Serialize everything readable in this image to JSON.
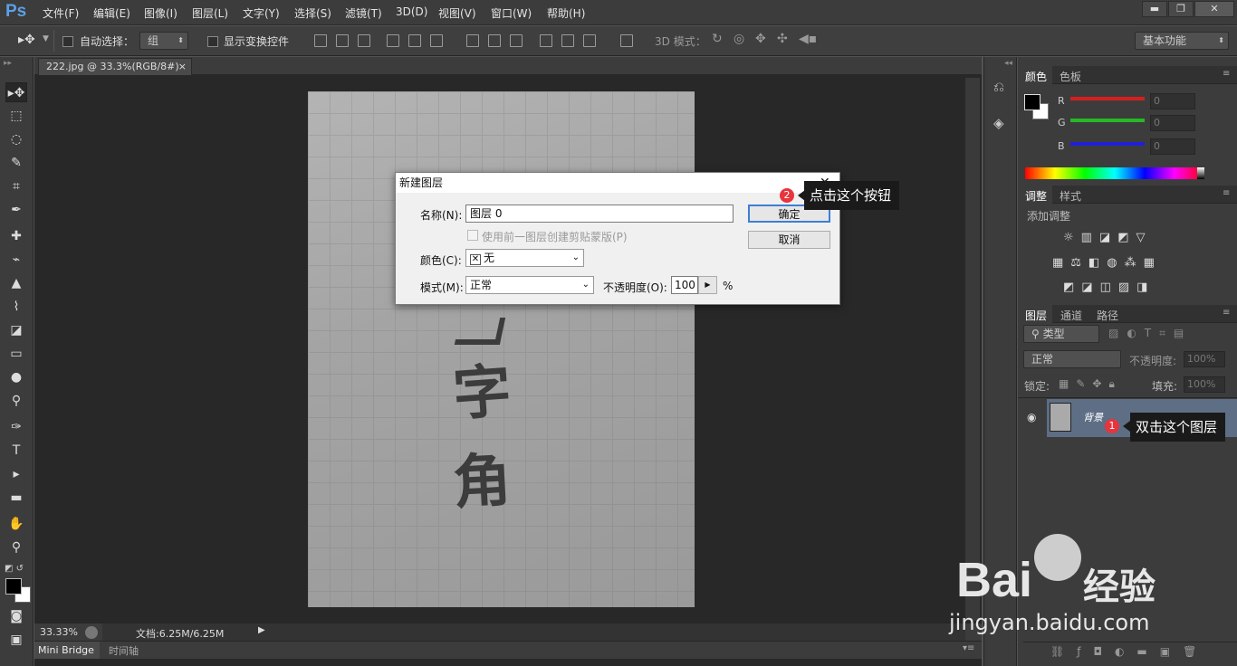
{
  "app": {
    "logo": "Ps"
  },
  "menu": [
    "文件(F)",
    "编辑(E)",
    "图像(I)",
    "图层(L)",
    "文字(Y)",
    "选择(S)",
    "滤镜(T)",
    "3D(D)",
    "视图(V)",
    "窗口(W)",
    "帮助(H)"
  ],
  "window_controls": {
    "minimize": "▬",
    "restore": "❐",
    "close": "✕"
  },
  "options": {
    "auto_select_label": "自动选择：",
    "auto_select_value": "组",
    "show_transform_label": "显示变换控件",
    "mode_3d_label": "3D 模式：",
    "workspace": "基本功能"
  },
  "doc": {
    "tab_title": "222.jpg @ 33.3%(RGB/8#)",
    "tab_close": "×",
    "zoom": "33.33%",
    "doc_size": "文档:6.25M/6.25M",
    "canvas_chars": [
      "字",
      "角"
    ]
  },
  "bottom_tabs": [
    "Mini Bridge",
    "时间轴"
  ],
  "color_panel": {
    "tabs": [
      "颜色",
      "色板"
    ],
    "channels": [
      {
        "label": "R",
        "value": "0",
        "color": "#d51f1f"
      },
      {
        "label": "G",
        "value": "0",
        "color": "#27b727"
      },
      {
        "label": "B",
        "value": "0",
        "color": "#2020d6"
      }
    ]
  },
  "adjust_panel": {
    "tabs": [
      "调整",
      "样式"
    ],
    "title": "添加调整"
  },
  "layers_panel": {
    "tabs": [
      "图层",
      "通道",
      "路径"
    ],
    "kind_label": "类型",
    "blend_mode": "正常",
    "opacity_label": "不透明度:",
    "opacity_value": "100%",
    "lock_label": "锁定:",
    "fill_label": "填充:",
    "fill_value": "100%",
    "layer_name": "背景"
  },
  "dialog": {
    "title": "新建图层",
    "close": "✕",
    "name_label": "名称(N):",
    "name_value": "图层 0",
    "clip_label": "使用前一图层创建剪贴蒙版(P)",
    "color_label": "颜色(C):",
    "color_value": "无",
    "mode_label": "模式(M):",
    "mode_value": "正常",
    "opacity_label": "不透明度(O):",
    "opacity_value": "100",
    "opacity_unit": "%",
    "ok": "确定",
    "cancel": "取消"
  },
  "annotations": {
    "step1_number": "1",
    "step1_text": "双击这个图层",
    "step2_number": "2",
    "step2_text": "点击这个按钮"
  },
  "watermark": {
    "brand": "Bai",
    "cn": "经验",
    "url": "jingyan.baidu.com"
  }
}
